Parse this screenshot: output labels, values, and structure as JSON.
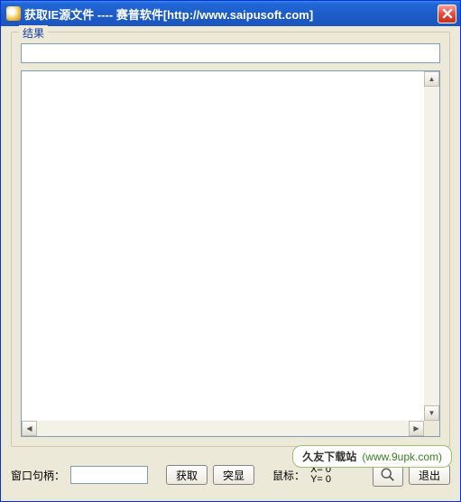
{
  "titlebar": {
    "text": "获取IE源文件 ---- 赛普软件[http://www.saipusoft.com]"
  },
  "group": {
    "label": "结果",
    "result_value": "",
    "textarea_value": ""
  },
  "bottom": {
    "handle_label": "窗口句柄：",
    "handle_value": "",
    "fetch_label": "获取",
    "highlight_label": "突显",
    "mouse_label": "鼠标：",
    "mouse_x": "X= 0",
    "mouse_y": "Y= 0",
    "exit_label": "退出"
  },
  "watermark": {
    "site": "久友下载站",
    "url": "(www.9upk.com)"
  }
}
